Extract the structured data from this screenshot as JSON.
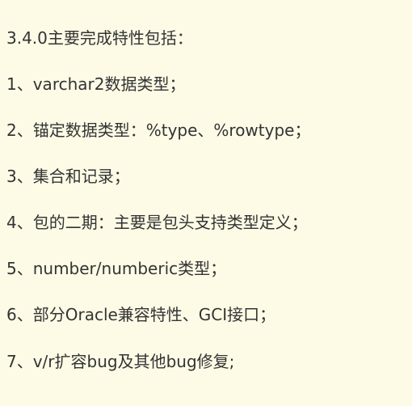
{
  "heading": "3.4.0主要完成特性包括：",
  "items": [
    "1、varchar2数据类型；",
    "2、锚定数据类型：%type、%rowtype；",
    "3、集合和记录；",
    "4、包的二期：主要是包头支持类型定义；",
    "5、number/numberic类型；",
    "6、部分Oracle兼容特性、GCI接口；",
    "7、v/r扩容bug及其他bug修复;"
  ]
}
